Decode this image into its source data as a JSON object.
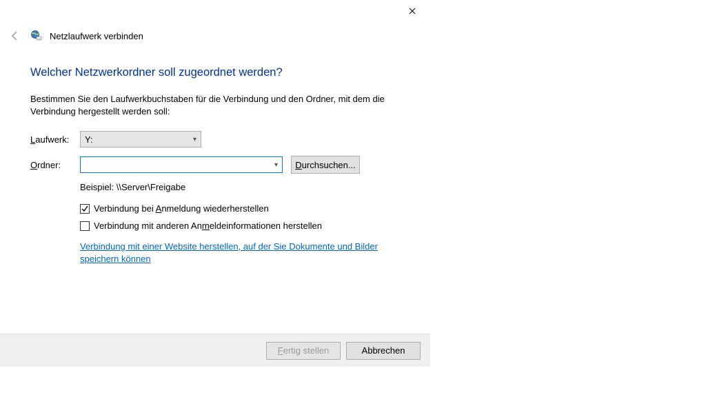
{
  "window": {
    "title": "Netzlaufwerk verbinden"
  },
  "headline": "Welcher Netzwerkordner soll zugeordnet werden?",
  "instruction": "Bestimmen Sie den Laufwerkbuchstaben für die Verbindung und den Ordner, mit dem die Verbindung hergestellt werden soll:",
  "labels": {
    "drive_pre": "L",
    "drive_rest": "aufwerk:",
    "folder_pre": "O",
    "folder_rest": "rdner:"
  },
  "drive": {
    "selected": "Y:"
  },
  "folder": {
    "value": "",
    "browse_pre": "D",
    "browse_rest": "urchsuchen..."
  },
  "example": "Beispiel: \\\\Server\\Freigabe",
  "checkbox_reconnect": {
    "checked": true,
    "pre": "Verbindung bei ",
    "u": "A",
    "rest": "nmeldung wiederherstellen"
  },
  "checkbox_othercreds": {
    "checked": false,
    "pre": "Verbindung mit anderen An",
    "u": "m",
    "rest": "eldeinformationen herstellen"
  },
  "link_text": "Verbindung mit einer Website herstellen, auf der Sie Dokumente und Bilder speichern können",
  "buttons": {
    "finish_pre": "F",
    "finish_rest": "ertig stellen",
    "cancel": "Abbrechen"
  }
}
